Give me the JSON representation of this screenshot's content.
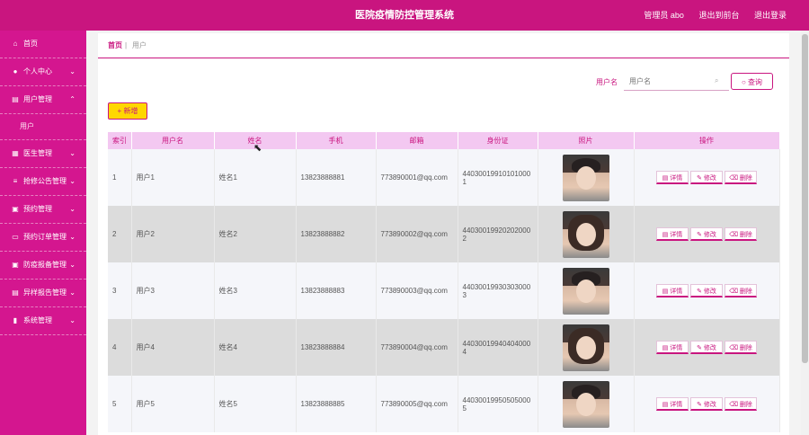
{
  "header": {
    "title": "医院疫情防控管理系统",
    "user": "管理员 abo",
    "front_link": "退出到前台",
    "logout": "退出登录"
  },
  "sidebar": {
    "items": [
      {
        "label": "首页",
        "icon": "home-icon",
        "chevron": false
      },
      {
        "label": "个人中心",
        "icon": "user-icon",
        "chevron": true
      },
      {
        "label": "用户管理",
        "icon": "doc-icon",
        "chevron": true,
        "expanded": true,
        "sub": "用户"
      },
      {
        "label": "医生管理",
        "icon": "grid-icon",
        "chevron": true
      },
      {
        "label": "抢修公告管理",
        "icon": "list-icon",
        "chevron": true
      },
      {
        "label": "预约管理",
        "icon": "book-icon",
        "chevron": true
      },
      {
        "label": "预约订单管理",
        "icon": "file-icon",
        "chevron": true
      },
      {
        "label": "防疫报备管理",
        "icon": "shield-icon",
        "chevron": true
      },
      {
        "label": "异样报告管理",
        "icon": "report-icon",
        "chevron": true
      },
      {
        "label": "系统管理",
        "icon": "chart-icon",
        "chevron": true
      }
    ]
  },
  "breadcrumb": {
    "home": "首页",
    "sep": "|",
    "current": "用户"
  },
  "search": {
    "label": "用户名",
    "placeholder": "用户名",
    "button": "查询"
  },
  "toolbar": {
    "add": "+ 新增"
  },
  "table": {
    "headers": [
      "索引",
      "用户名",
      "姓名",
      "手机",
      "邮箱",
      "身份证",
      "照片",
      "操作"
    ],
    "actions": {
      "detail": "详情",
      "edit": "修改",
      "delete": "删除"
    },
    "rows": [
      {
        "idx": "1",
        "username": "用户1",
        "name": "姓名1",
        "phone": "13823888881",
        "email": "773890001@qq.com",
        "idcard": "440300199101010001",
        "photo": "male"
      },
      {
        "idx": "2",
        "username": "用户2",
        "name": "姓名2",
        "phone": "13823888882",
        "email": "773890002@qq.com",
        "idcard": "440300199202020002",
        "photo": "female"
      },
      {
        "idx": "3",
        "username": "用户3",
        "name": "姓名3",
        "phone": "13823888883",
        "email": "773890003@qq.com",
        "idcard": "440300199303030003",
        "photo": "male"
      },
      {
        "idx": "4",
        "username": "用户4",
        "name": "姓名4",
        "phone": "13823888884",
        "email": "773890004@qq.com",
        "idcard": "440300199404040004",
        "photo": "female"
      },
      {
        "idx": "5",
        "username": "用户5",
        "name": "姓名5",
        "phone": "13823888885",
        "email": "773890005@qq.com",
        "idcard": "440300199505050005",
        "photo": "male"
      }
    ]
  },
  "colors": {
    "brand": "#c9157f",
    "sidebar": "#d4168f",
    "header_row": "#f3c8f1",
    "add_button": "#ffd700"
  }
}
